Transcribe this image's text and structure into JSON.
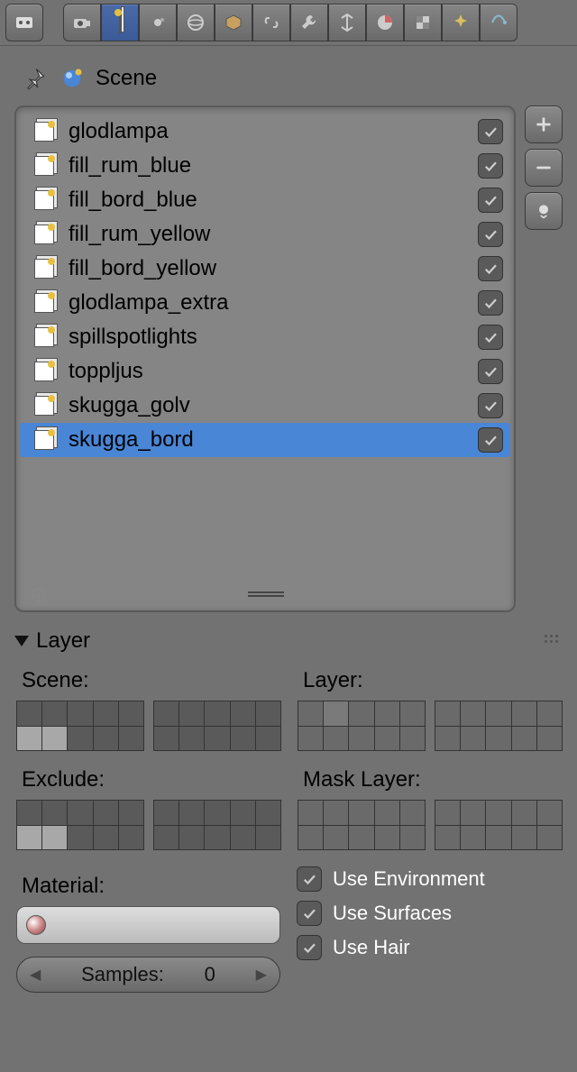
{
  "header": {
    "datablock_label": "Scene"
  },
  "tabs": [
    "render",
    "render-layers",
    "scene",
    "world",
    "object",
    "constraints",
    "modifiers",
    "data",
    "material",
    "texture",
    "particles",
    "physics"
  ],
  "active_tab": 1,
  "layers": [
    {
      "name": "glodlampa",
      "enabled": true,
      "selected": false
    },
    {
      "name": "fill_rum_blue",
      "enabled": true,
      "selected": false
    },
    {
      "name": "fill_bord_blue",
      "enabled": true,
      "selected": false
    },
    {
      "name": "fill_rum_yellow",
      "enabled": true,
      "selected": false
    },
    {
      "name": "fill_bord_yellow",
      "enabled": true,
      "selected": false
    },
    {
      "name": "glodlampa_extra",
      "enabled": true,
      "selected": false
    },
    {
      "name": "spillspotlights",
      "enabled": true,
      "selected": false
    },
    {
      "name": "toppljus",
      "enabled": true,
      "selected": false
    },
    {
      "name": "skugga_golv",
      "enabled": true,
      "selected": false
    },
    {
      "name": "skugga_bord",
      "enabled": true,
      "selected": true
    }
  ],
  "section": {
    "title": "Layer",
    "scene_label": "Scene:",
    "layer_label": "Layer:",
    "exclude_label": "Exclude:",
    "mask_label": "Mask Layer:",
    "material_label": "Material:",
    "samples_label": "Samples:",
    "samples_value": "0",
    "use_env": "Use Environment",
    "use_surfaces": "Use Surfaces",
    "use_hair": "Use Hair",
    "use_env_checked": true,
    "use_surfaces_checked": true,
    "use_hair_checked": true
  },
  "layer_grids": {
    "scene_a": {
      "dark": true,
      "on": [
        5,
        6
      ],
      "sel": []
    },
    "scene_b": {
      "dark": true,
      "on": [],
      "sel": []
    },
    "layer_a": {
      "dark": false,
      "on": [],
      "sel": [
        1
      ]
    },
    "layer_b": {
      "dark": false,
      "on": [],
      "sel": []
    },
    "exclude_a": {
      "dark": true,
      "on": [
        5,
        6
      ],
      "sel": []
    },
    "exclude_b": {
      "dark": true,
      "on": [],
      "sel": []
    },
    "mask_a": {
      "dark": false,
      "on": [],
      "sel": []
    },
    "mask_b": {
      "dark": false,
      "on": [],
      "sel": []
    }
  }
}
